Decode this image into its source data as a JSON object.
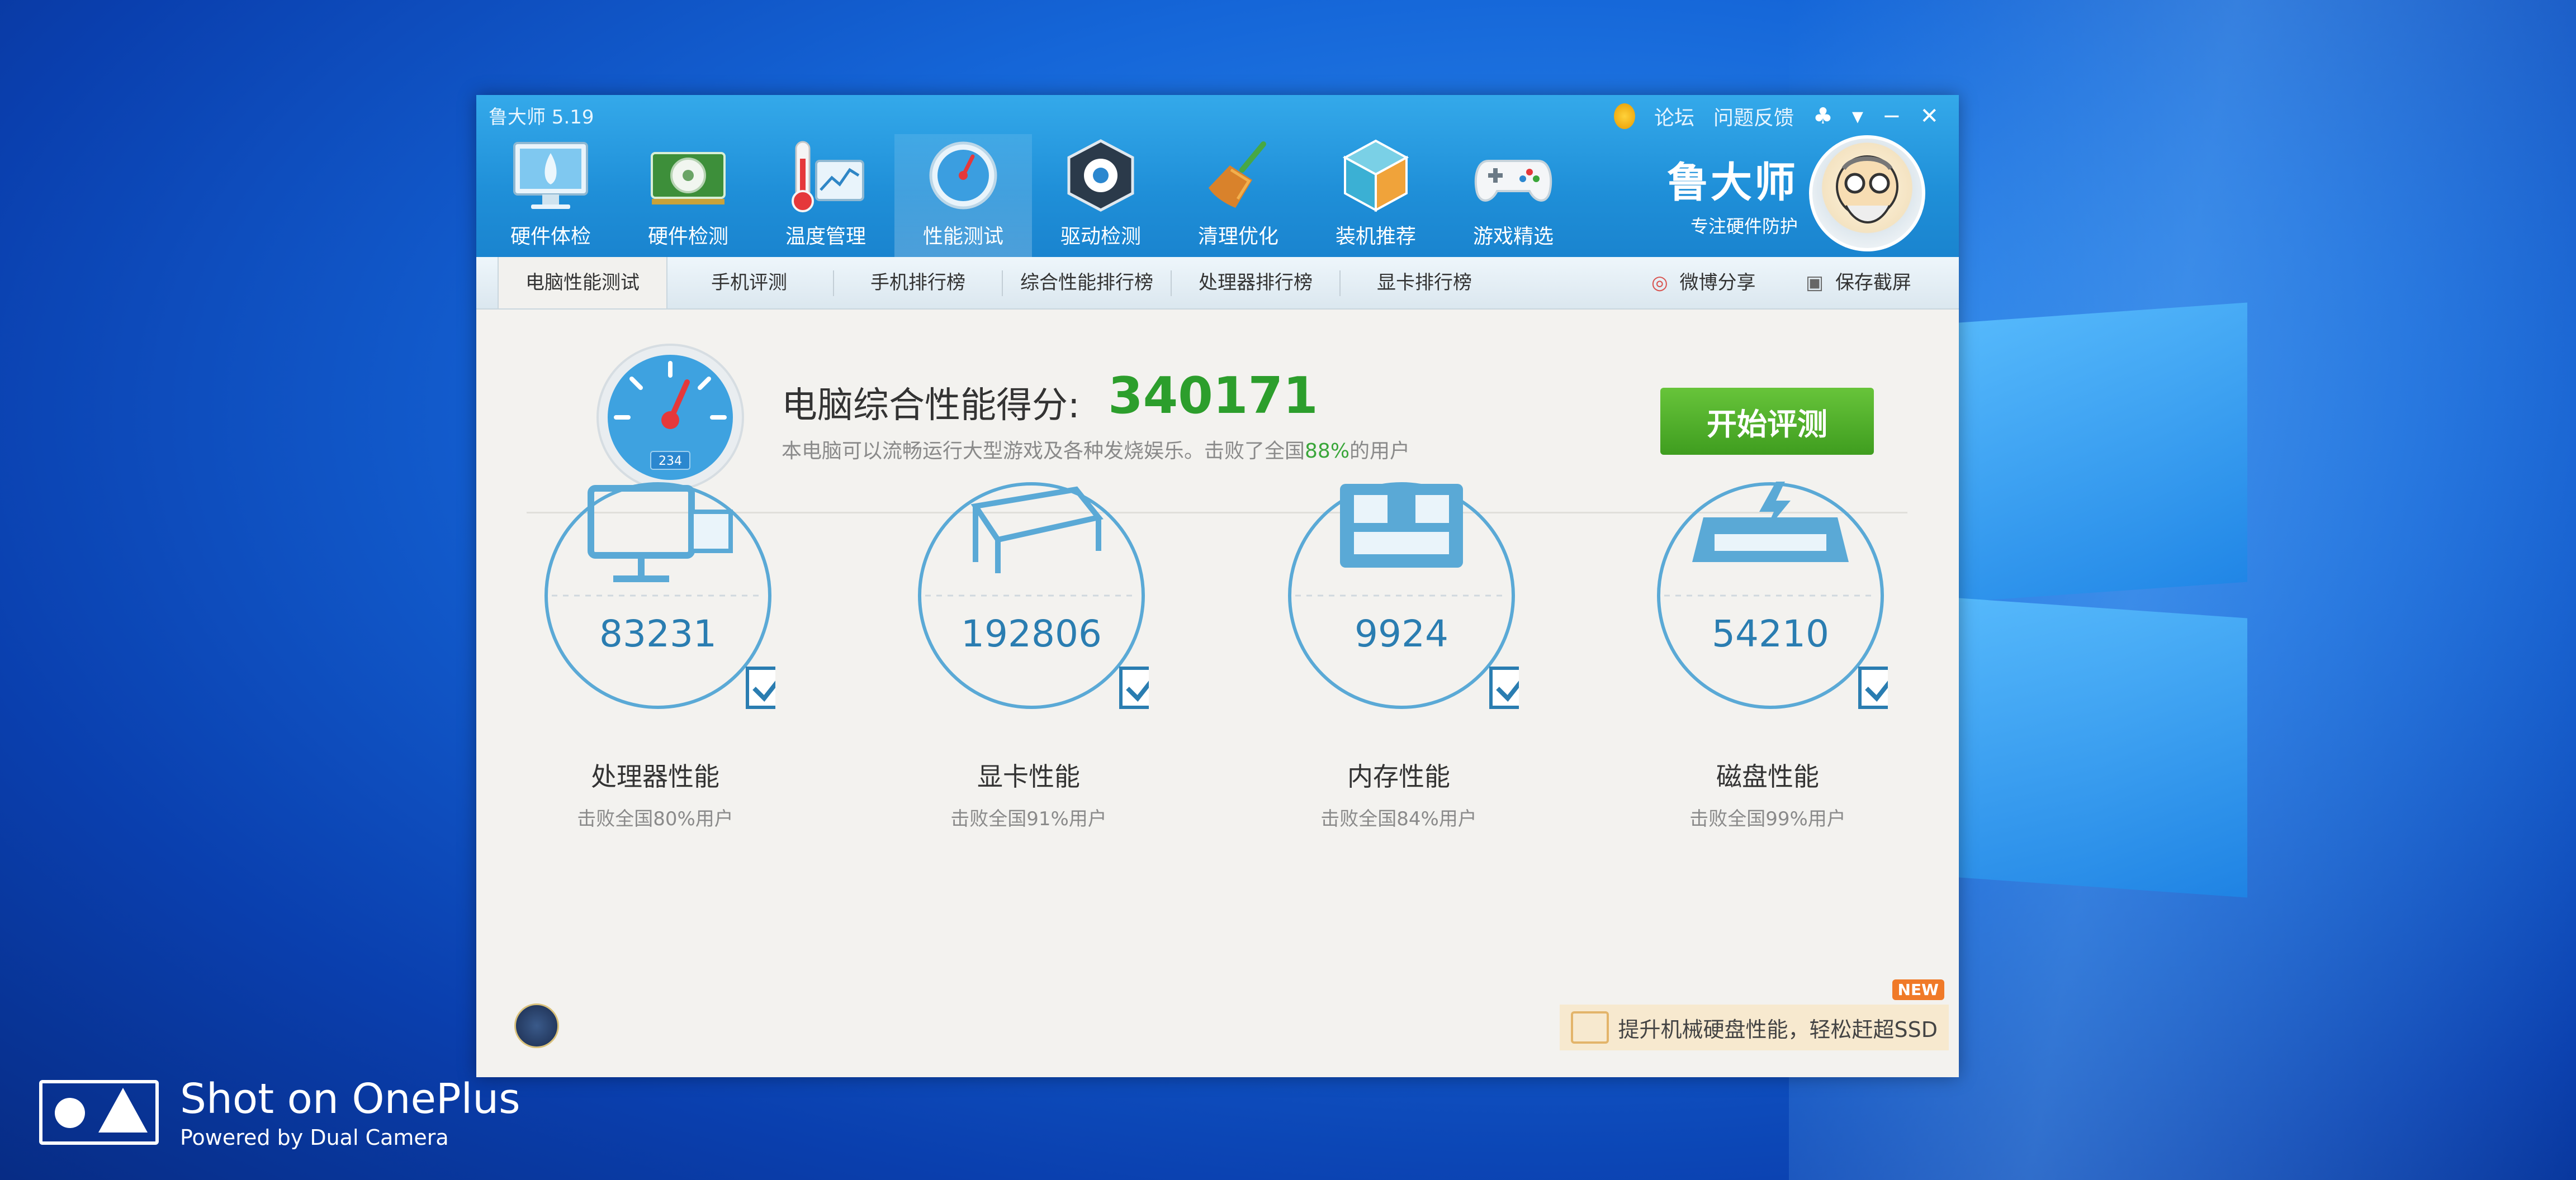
{
  "app": {
    "title": "鲁大师 5.19",
    "top_links": [
      "论坛",
      "问题反馈"
    ],
    "controls": {
      "skin": "♣",
      "menu": "▾",
      "minimize": "−",
      "close": "✕"
    }
  },
  "nav": [
    {
      "label": "硬件体检",
      "icon": "monitor-icon"
    },
    {
      "label": "硬件检测",
      "icon": "graphics-card-icon"
    },
    {
      "label": "温度管理",
      "icon": "thermometer-icon"
    },
    {
      "label": "性能测试",
      "icon": "speedometer-icon",
      "active": true
    },
    {
      "label": "驱动检测",
      "icon": "driver-gear-icon"
    },
    {
      "label": "清理优化",
      "icon": "broom-icon"
    },
    {
      "label": "装机推荐",
      "icon": "cube-icon"
    },
    {
      "label": "游戏精选",
      "icon": "gamepad-icon"
    }
  ],
  "brand": {
    "name": "鲁大师",
    "slogan": "专注硬件防护"
  },
  "tabs": [
    "电脑性能测试",
    "手机评测",
    "手机排行榜",
    "综合性能排行榜",
    "处理器排行榜",
    "显卡排行榜"
  ],
  "share": {
    "weibo": "微博分享",
    "screenshot": "保存截屏"
  },
  "score": {
    "label": "电脑综合性能得分:",
    "value": "340171",
    "desc_prefix": "本电脑可以流畅运行大型游戏及各种发烧娱乐。击败了全国",
    "desc_pct": "88%",
    "desc_suffix": "的用户",
    "gauge_digits": "234"
  },
  "start_button": "开始评测",
  "cards": [
    {
      "value": "83231",
      "name": "处理器性能",
      "sub": "击败全国80%用户",
      "icon": "cpu-monitor-icon"
    },
    {
      "value": "192806",
      "name": "显卡性能",
      "sub": "击败全国91%用户",
      "icon": "gpu-box-icon"
    },
    {
      "value": "9924",
      "name": "内存性能",
      "sub": "击败全国84%用户",
      "icon": "memory-chip-icon"
    },
    {
      "value": "54210",
      "name": "磁盘性能",
      "sub": "击败全国99%用户",
      "icon": "disk-drive-icon"
    }
  ],
  "banner": {
    "text": "提升机械硬盘性能，轻松赶超SSD",
    "badge": "NEW"
  },
  "watermark": {
    "title": "Shot on OnePlus",
    "subtitle": "Powered by Dual Camera"
  },
  "colors": {
    "accent": "#1f8fd8",
    "score_green": "#2c9e2c",
    "button_green": "#4caf27",
    "card_blue": "#2a7db1"
  }
}
